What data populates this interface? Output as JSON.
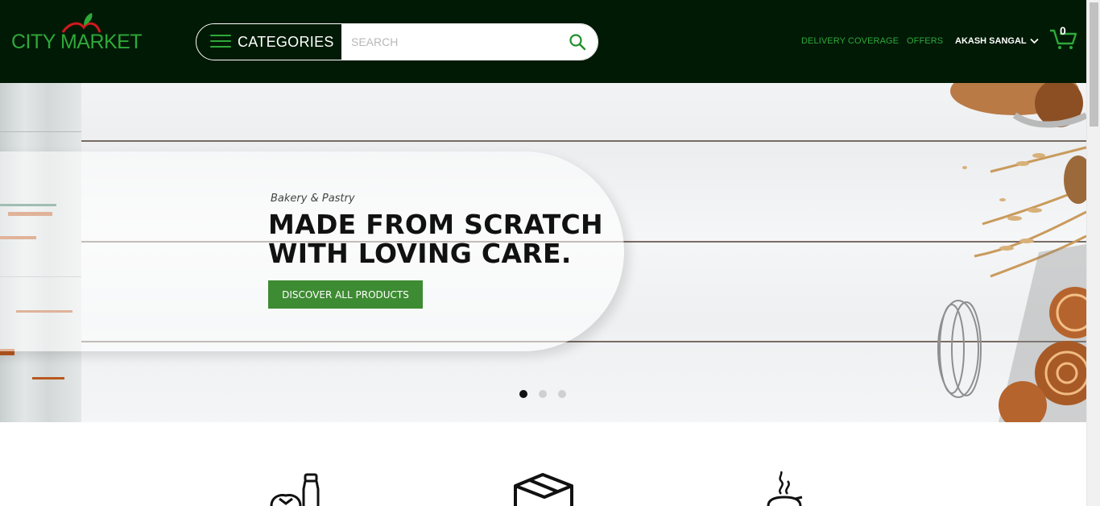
{
  "brand": {
    "name": "CITY MARKET"
  },
  "header": {
    "categories_label": "CATEGORIES",
    "search_placeholder": "SEARCH",
    "nav": {
      "delivery": "DELIVERY COVERAGE",
      "offers": "OFFERS"
    },
    "user": "AKASH SANGAL",
    "cart_count": "0"
  },
  "hero": {
    "subtitle": "Bakery & Pastry",
    "title_line1": "MADE FROM SCRATCH",
    "title_line2": "WITH LOVING CARE.",
    "cta": "DISCOVER ALL PRODUCTS",
    "slides": 3,
    "active_slide": 1
  },
  "colors": {
    "header_bg": "#001a05",
    "accent": "#2fa83a",
    "cta_bg": "#3d8b32"
  },
  "icons": [
    "apple-logo-icon",
    "hamburger-icon",
    "search-icon",
    "chevron-down-icon",
    "cart-icon",
    "grocery-icon",
    "box-icon",
    "hot-food-icon"
  ]
}
